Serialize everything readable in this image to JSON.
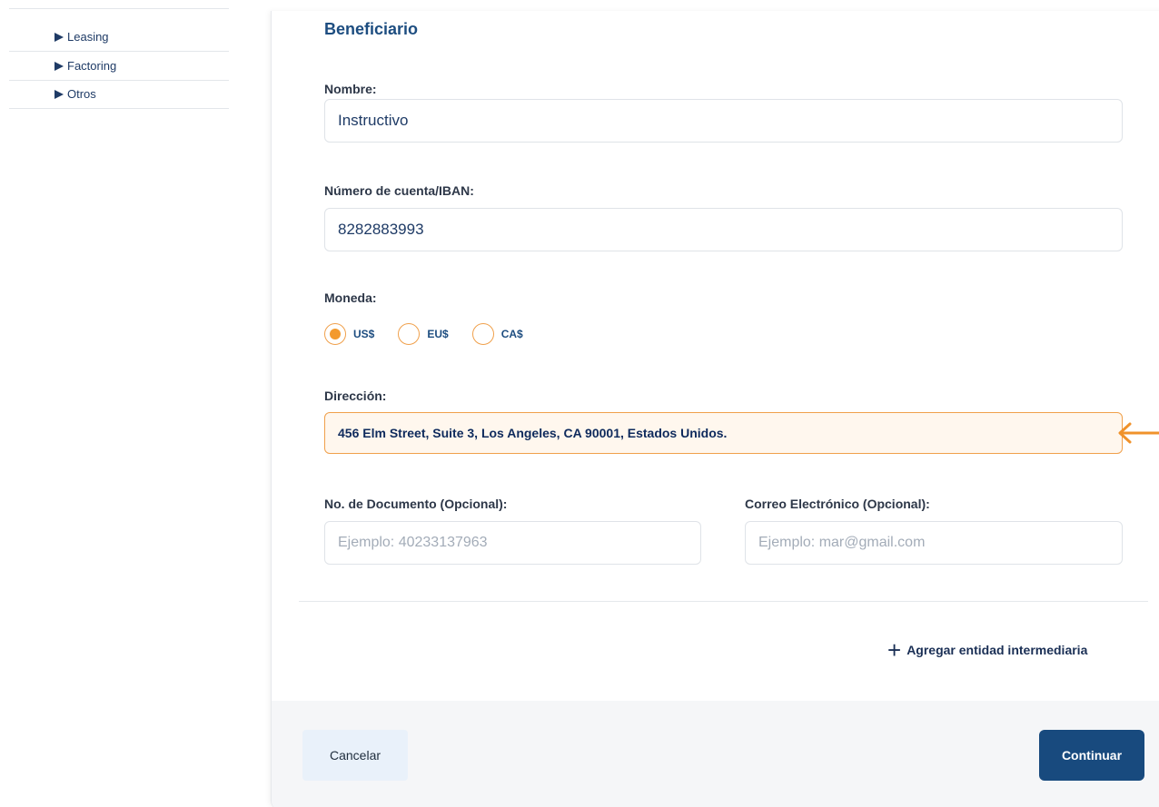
{
  "sidebar": {
    "items": [
      {
        "label": "Leasing"
      },
      {
        "label": "Factoring"
      },
      {
        "label": "Otros"
      }
    ]
  },
  "form": {
    "section_title": "Beneficiario",
    "nombre": {
      "label": "Nombre:",
      "value": "Instructivo"
    },
    "cuenta": {
      "label": "Número de cuenta/IBAN:",
      "value": "8282883993"
    },
    "moneda": {
      "label": "Moneda:",
      "options": [
        "US$",
        "EU$",
        "CA$"
      ],
      "selected": "US$"
    },
    "direccion": {
      "label": "Dirección:",
      "value": "456 Elm Street, Suite 3, Los Angeles, CA 90001, Estados Unidos."
    },
    "documento": {
      "label": "No. de Documento (Opcional):",
      "placeholder": "Ejemplo: 40233137963"
    },
    "correo": {
      "label": "Correo Electrónico (Opcional):",
      "placeholder": "Ejemplo: mar@gmail.com"
    }
  },
  "actions": {
    "add_intermediary": "Agregar entidad intermediaria",
    "cancel": "Cancelar",
    "continue": "Continuar"
  },
  "colors": {
    "primary": "#184a7e",
    "accent": "#f39a2d",
    "highlight_bg": "#fff7ee"
  }
}
